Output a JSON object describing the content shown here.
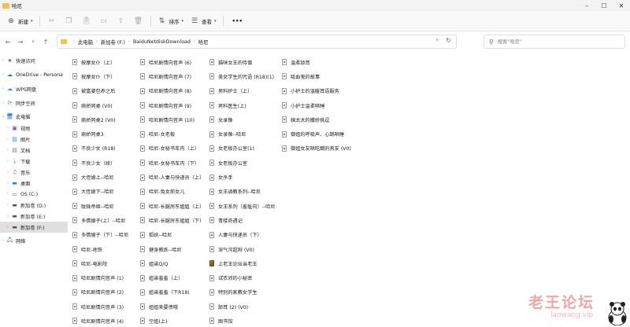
{
  "window": {
    "title": "哈尼"
  },
  "toolbar": {
    "new_label": "新建",
    "sort_label": "排序",
    "view_label": "查看",
    "more_label": "•••"
  },
  "address": {
    "crumbs": [
      "此电脑",
      "新加卷 (F:)",
      "BaiduNetdiskDownload",
      "哈尼"
    ]
  },
  "search": {
    "placeholder": "搜索\"哈尼\""
  },
  "sidebar": {
    "items": [
      {
        "label": "快速访问",
        "icon": "star-icon"
      },
      {
        "label": "OneDrive - Persona",
        "icon": "cloud-icon"
      },
      {
        "label": "WPS网盘",
        "icon": "cloud-icon"
      },
      {
        "label": "同步空间",
        "icon": "sync-icon"
      },
      {
        "label": "此电脑",
        "icon": "computer-icon"
      },
      {
        "label": "视频",
        "icon": "video-icon"
      },
      {
        "label": "图片",
        "icon": "image-icon"
      },
      {
        "label": "文档",
        "icon": "document-icon"
      },
      {
        "label": "下载",
        "icon": "download-icon"
      },
      {
        "label": "音乐",
        "icon": "music-icon"
      },
      {
        "label": "桌面",
        "icon": "desktop-icon"
      },
      {
        "label": "OS (C:)",
        "icon": "drive-icon"
      },
      {
        "label": "新加卷 (D:)",
        "icon": "drive-icon"
      },
      {
        "label": "新加卷 (E:)",
        "icon": "drive-icon"
      },
      {
        "label": "新加卷 (F:)",
        "icon": "drive-icon"
      },
      {
        "label": "网络",
        "icon": "network-icon"
      }
    ]
  },
  "files": {
    "col1": [
      "按摩女仆（上）",
      "按摩女仆（下）",
      "被富婆包养之后",
      "病娇同桌 (V0)",
      "病娇同桌2 (V0)",
      "病娇同桌3",
      "不良少女 (R18)",
      "不良少女（续）",
      "大侄媳上--哈尼",
      "大侄媳下--哈尼",
      "耽珠帝姬--哈尼",
      "多情嫂子(上）--哈尼",
      "多情嫂子（下）--哈尼",
      "哈尼-地铁",
      "哈尼-电影院",
      "哈尼剧情向音声 (1)",
      "哈尼剧情向音声 (2)",
      "哈尼剧情向音声 (3)",
      "哈尼剧情向音声 (4)",
      "哈尼剧情向音声 (5)"
    ],
    "col2": [
      "哈尼剧情向音声 (6)",
      "哈尼剧情向音声 (7)",
      "哈尼剧情向音声 (8)",
      "哈尼剧情向音声 (9)",
      "哈尼剧情向音声 (10)",
      "哈尼-女老板",
      "哈尼-女秘书车内（上）",
      "哈尼-女秘书车内（下）",
      "哈尼-人妻与快递员（上）",
      "哈尼-兔女郎女儿",
      "哈尼-长腿房东姐姐（上）",
      "哈尼-长腿房东姐姐（下）",
      "狐妖--哈尼",
      "健身教练--哈尼",
      "姐弟Q/Q",
      "姐弟羞羞（上）",
      "姐弟羞羞（下R18)",
      "姐姐来要债哦",
      "空姐(上)",
      "老公天下第一 (V0)"
    ],
    "col3": [
      "猫咪女王的侍僧",
      "美女学生的咒语 (R18)(1)",
      "男科护士（上）",
      "男科医生(上)",
      "女录像",
      "女录像--哈尼",
      "女老板办公室(1)",
      "女老板办公室",
      "女杀手",
      "女王调教系列--哈尼",
      "女王系列（羞耻向）--哈尼",
      "青楼奇遇记",
      "人妻与快递员（下）",
      "深气沟超辩 (V0)",
      "上老王论坛当老王",
      "试衣间的小秘密",
      "特别的家教女学生",
      "舔耳 (2) (V0)",
      "图书馆",
      "温柔舔耳(1)"
    ],
    "col4": [
      "温柔舔耳",
      "吸血鬼的故事",
      "小护士的温暖耳语服务",
      "小护士温柔哄睡",
      "姨太太的撒娇挑逗",
      "御姐的呼吸声、心跳哄睡",
      "御姐女友哄吃醋的男友 (V0)"
    ],
    "picture_item": "上老王论坛当老王"
  },
  "watermark": {
    "text": "老王论坛",
    "subtext": "laowang.vip"
  }
}
